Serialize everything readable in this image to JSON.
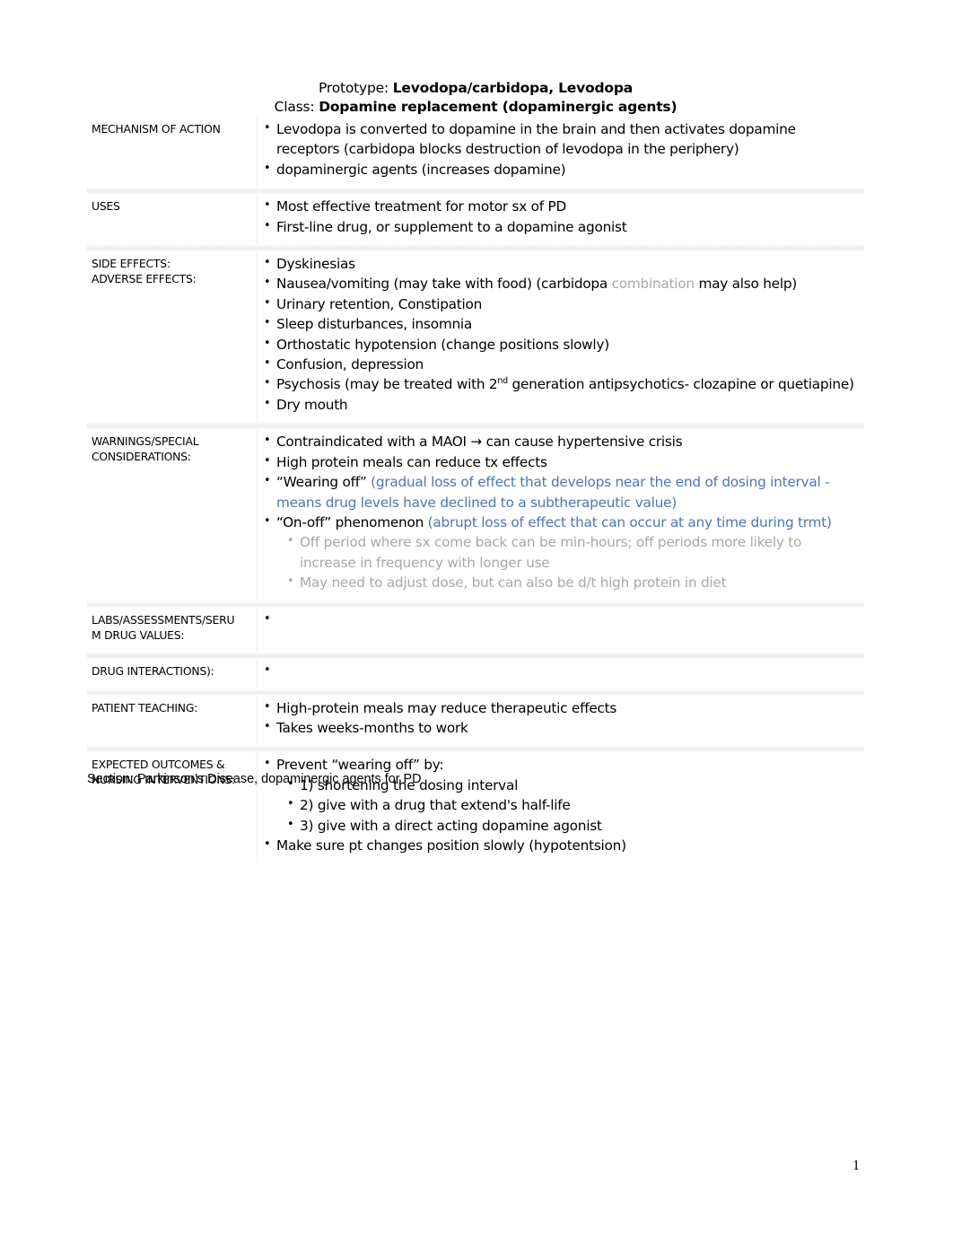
{
  "header": {
    "prototype_label": "Prototype:",
    "prototype_value": "Levodopa/carbidopa, Levodopa",
    "class_label": "Class:",
    "class_value": "Dopamine replacement (dopaminergic agents)"
  },
  "colors": {
    "blue_text": "#4a77b4",
    "grey_text": "#a8a8a8",
    "black_text": "#000000",
    "row_separator": "#ececec"
  },
  "rows": [
    {
      "label_lines": [
        "MECHANISM OF ACTION"
      ],
      "bullets": [
        {
          "color": "blue",
          "text": "Levodopa is converted to dopamine in the brain and then activates dopamine receptors (carbidopa blocks destruction of levodopa in the periphery)"
        },
        {
          "color": "black",
          "text": "dopaminergic agents (increases dopamine)"
        }
      ]
    },
    {
      "label_lines": [
        "USES"
      ],
      "bullets": [
        {
          "color": "black",
          "text": " Most effective treatment for motor sx of PD"
        },
        {
          "color": "blue",
          "text": "First-line drug, or supplement to a dopamine agonist"
        }
      ]
    },
    {
      "label_lines": [
        "SIDE EFFECTS:",
        "ADVERSE EFFECTS:"
      ],
      "bullets": [
        {
          "color": "black",
          "text": "Dyskinesias"
        },
        {
          "color": "black",
          "rich": [
            {
              "t": "Nausea/vomiting (may take with food) (carbidopa ",
              "c": "black"
            },
            {
              "t": "combination",
              "c": "grey"
            },
            {
              "t": " may also help)",
              "c": "black"
            }
          ],
          "text": "Nausea/vomiting (may take with food) (carbidopa combination may also help)"
        },
        {
          "color": "black",
          "text": "Urinary retention, Constipation"
        },
        {
          "color": "black",
          "text": "Sleep disturbances, insomnia"
        },
        {
          "color": "black",
          "text": "Orthostatic hypotension (change positions slowly)"
        },
        {
          "color": "black",
          "text": "Confusion, depression"
        },
        {
          "color": "black",
          "sup": true,
          "pre": "Psychosis (may be treated with 2",
          "sup_text": "nd",
          "post": " generation antipsychotics- clozapine or quetiapine)",
          "text": "Psychosis (may be treated with 2nd generation antipsychotics- clozapine or quetiapine)"
        },
        {
          "color": "black",
          "text": "Dry mouth"
        }
      ]
    },
    {
      "label_lines": [
        "WARNINGS/SPECIAL",
        "CONSIDERATIONS:"
      ],
      "bullets": [
        {
          "color": "black",
          "text": "Contraindicated with a MAOI → can cause hypertensive crisis"
        },
        {
          "color": "black",
          "text": "High protein meals can reduce tx effects"
        },
        {
          "color": "black",
          "rich": [
            {
              "t": "“Wearing off” ",
              "c": "black"
            },
            {
              "t": "(gradual loss of effect that develops near the end of dosing interval - means drug levels have declined to a subtherapeutic value)",
              "c": "blue"
            }
          ],
          "text": "“Wearing off” (gradual loss of effect that develops near the end of dosing interval - means drug levels have declined to a subtherapeutic value)"
        },
        {
          "color": "black",
          "rich": [
            {
              "t": "“On-off” phenomenon ",
              "c": "black"
            },
            {
              "t": "(abrupt loss of effect that can occur at any time during trmt)",
              "c": "blue"
            }
          ],
          "text": "“On-off” phenomenon (abrupt loss of effect that can occur at any time during trmt)",
          "sub_bullets": [
            {
              "color": "grey",
              "text": "Off period where sx come back can be min-hours; off periods more likely to increase in frequency with longer use"
            },
            {
              "color": "grey",
              "text": "May need to adjust dose, but can also be d/t high protein in diet"
            }
          ]
        }
      ]
    },
    {
      "label_lines": [
        "LABS/ASSESSMENTS/SERU",
        "M DRUG VALUES:"
      ],
      "bullets": [
        {
          "color": "black",
          "text": ""
        }
      ]
    },
    {
      "label_lines": [
        "DRUG INTERACTIONS):"
      ],
      "bullets": [
        {
          "color": "black",
          "text": ""
        }
      ]
    },
    {
      "label_lines": [
        "PATIENT TEACHING:"
      ],
      "bullets": [
        {
          "color": "black",
          "text": "High-protein meals may reduce therapeutic effects"
        },
        {
          "color": "black",
          "text": "Takes weeks-months to work"
        }
      ]
    },
    {
      "label_lines": [
        "EXPECTED OUTCOMES &",
        "NURSING INTERVENTIONS:"
      ],
      "bullets": [
        {
          "color": "black",
          "text": "Prevent “wearing off” by:",
          "sub_bullets": [
            {
              "color": "black",
              "text": "1) shortening the dosing interval"
            },
            {
              "color": "black",
              "text": "2) give with a drug that extend's half-life"
            },
            {
              "color": "black",
              "text": "3) give with a direct acting dopamine agonist"
            }
          ]
        },
        {
          "color": "grey",
          "text": "Make sure pt changes position slowly (hypotentsion)"
        }
      ]
    }
  ],
  "footer": {
    "section_text": "Section:  Parkinson’s Disease, dopaminergic agents for PD",
    "page_number": "1"
  }
}
